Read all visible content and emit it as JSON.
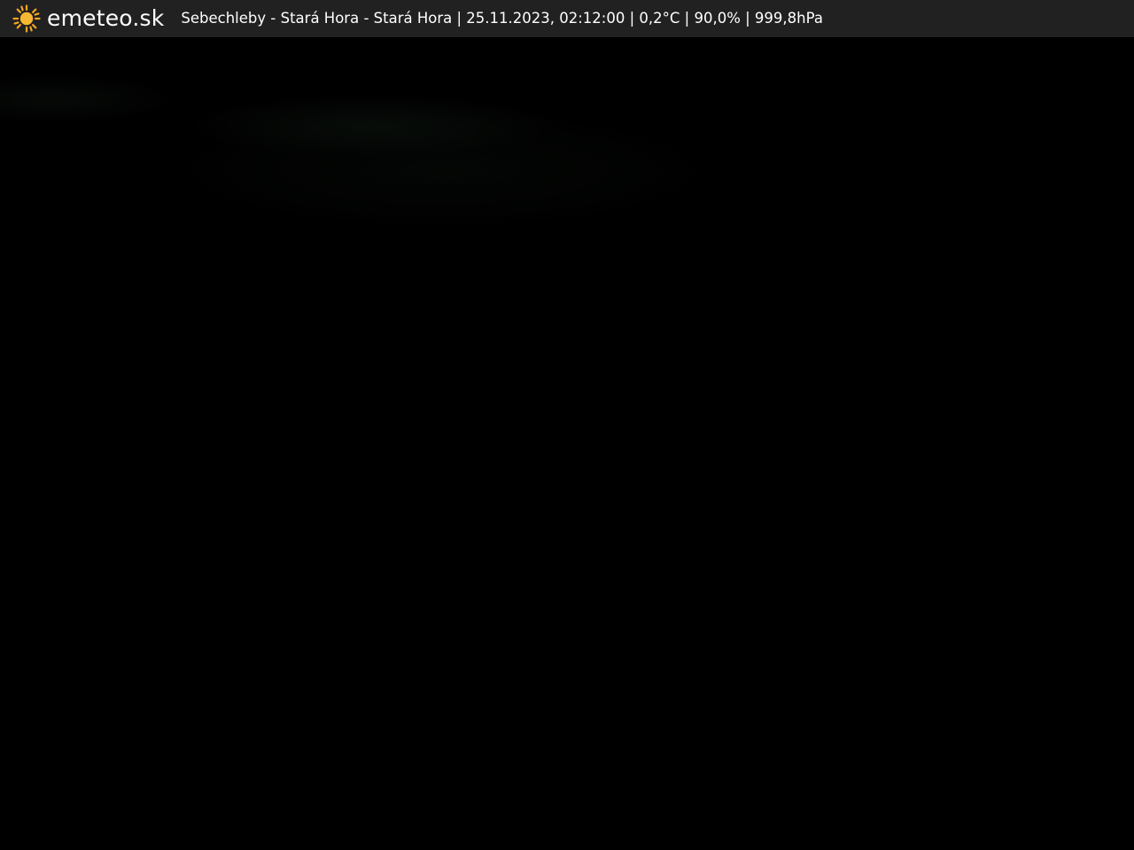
{
  "logo": {
    "icon": "sun-icon",
    "text": "emeteo.sk",
    "icon_color": "#f5a623"
  },
  "caption": {
    "text": "Sebechleby - Stará Hora - Stará Hora | 25.11.2023, 02:12:00 | 0,2°C | 90,0% | 999,8hPa"
  },
  "colors": {
    "bar_background": "#212121",
    "image_background": "#000000",
    "text": "#ffffff"
  }
}
